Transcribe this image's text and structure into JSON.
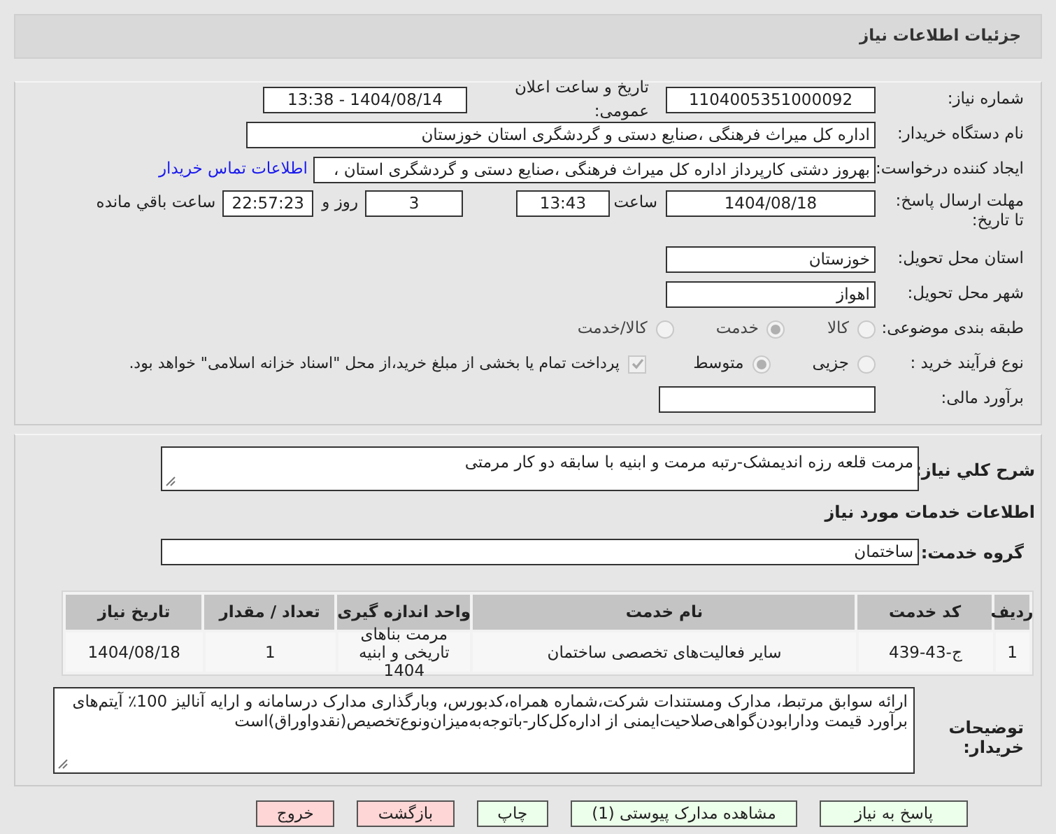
{
  "title": "جزئیات اطلاعات نیاز",
  "need_number": {
    "label": "شماره نیاز:",
    "value": "1104005351000092"
  },
  "announce": {
    "label": "تاریخ و ساعت اعلان عمومی:",
    "value": "1404/08/14 - 13:38"
  },
  "buyer_org": {
    "label": "نام دستگاه خریدار:",
    "value": "اداره کل میراث فرهنگی ،صنایع دستی و گردشگری استان خوزستان"
  },
  "requester": {
    "label": "ایجاد کننده درخواست:",
    "value": "بهروز دشتی کارپرداز اداره کل میراث فرهنگی ،صنایع دستی و گردشگری استان ،",
    "link": "اطلاعات تماس خریدار"
  },
  "deadline": {
    "label": "مهلت ارسال پاسخ: تا تاریخ:",
    "date": "1404/08/18",
    "time_label": "ساعت",
    "time": "13:43",
    "days": "3",
    "days_label": "روز و",
    "remaining": "22:57:23",
    "remaining_label": "ساعت باقي مانده"
  },
  "province": {
    "label": "استان محل تحویل:",
    "value": "خوزستان"
  },
  "city": {
    "label": "شهر محل تحویل:",
    "value": "اهواز"
  },
  "category": {
    "label": "طبقه بندی موضوعی:",
    "options": [
      {
        "label": "كالا",
        "selected": false
      },
      {
        "label": "خدمت",
        "selected": true
      },
      {
        "label": "كالا/خدمت",
        "selected": false
      }
    ]
  },
  "process": {
    "label": "نوع فرآیند خرید :",
    "options": [
      {
        "label": "جزیی",
        "selected": false
      },
      {
        "label": "متوسط",
        "selected": true
      }
    ],
    "payment": {
      "checked": true,
      "text": "پرداخت تمام یا بخشی از مبلغ خرید،از محل \"اسناد خزانه اسلامی\" خواهد بود."
    }
  },
  "budget": {
    "label": "برآورد مالی:"
  },
  "description": {
    "label": "شرح کلي نیاز:",
    "value": "مرمت قلعه رزه اندیمشک-رتبه مرمت و ابنیه با سابقه دو کار مرمتی"
  },
  "services_heading": "اطلاعات خدمات مورد نیاز",
  "service_group": {
    "label": "گروه خدمت:",
    "value": "ساختمان"
  },
  "table": {
    "columns": [
      "ردیف",
      "کد خدمت",
      "نام خدمت",
      "واحد اندازه گیری",
      "تعداد / مقدار",
      "تاریخ نیاز"
    ],
    "rows": [
      [
        "1",
        "ج-43-439",
        "سایر فعالیت‌های تخصصی ساختمان",
        "مرمت بناهای تاریخی و ابنیه 1404",
        "1",
        "1404/08/18"
      ]
    ]
  },
  "notes": {
    "label": "توضیحات خریدار:",
    "value": "ارائه سوابق مرتبط، مدارک ومستندات شرکت،شماره همراه،کدبورس، وبارگذاری مدارک درسامانه و ارایه آنالیز 100٪ آیتم‌های برآورد قیمت ودارابودن‌گواهی‌صلاحیت‌ایمنی از اداره‌کل‌کار-باتوجه‌به‌میزان‌ونوع‌تخصیص(نقدواوراق)است"
  },
  "buttons": [
    {
      "label": "پاسخ به نیاز",
      "kind": "primary"
    },
    {
      "label": "مشاهده مدارک پیوستی (1)",
      "kind": "primary"
    },
    {
      "label": "چاپ",
      "kind": "primary"
    },
    {
      "label": "بازگشت",
      "kind": "danger"
    },
    {
      "label": "خروج",
      "kind": "danger"
    }
  ]
}
